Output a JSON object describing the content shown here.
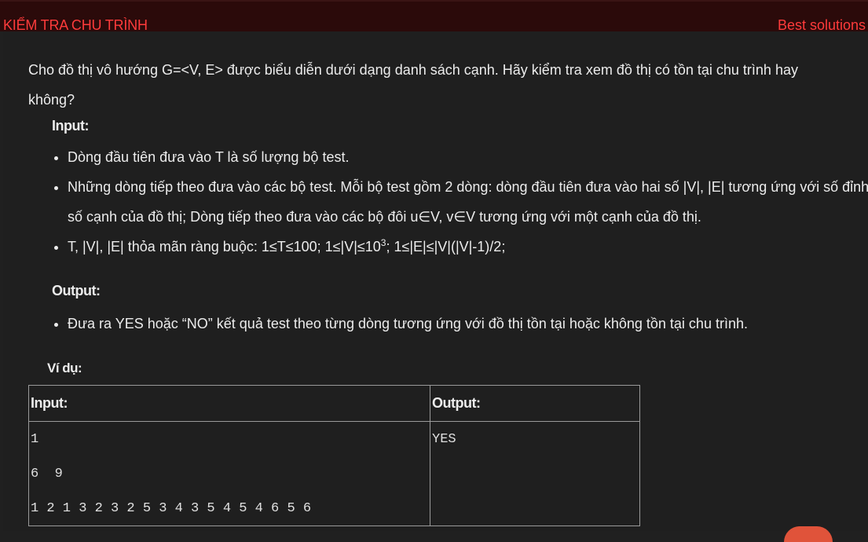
{
  "header": {
    "title": "KIỂM TRA CHU TRÌNH",
    "best_solutions": "Best solutions"
  },
  "problem": {
    "intro": "Cho đồ thị vô hướng G=<V, E> được biểu diễn dưới dạng danh sách cạnh. Hãy kiểm tra xem đồ thị có tồn tại chu trình hay không?",
    "input_heading": "Input:",
    "input_items": [
      "Dòng đầu tiên đưa vào T là số lượng bộ test.",
      "Những dòng tiếp theo đưa vào các bộ test. Mỗi bộ test gồm 2 dòng: dòng đầu tiên đưa vào hai số |V|, |E| tương ứng với số đỉnh,  số cạnh của đồ thị; Dòng tiếp theo đưa vào các bộ đôi u∈V, v∈V tương ứng với một cạnh của đồ thị."
    ],
    "constraint_before": "T, |V|, |E| thỏa mãn ràng buộc: 1≤T≤100; 1≤|V|≤10",
    "constraint_sup": "3",
    "constraint_after": "; 1≤|E|≤|V|(|V|-1)/2;",
    "output_heading": "Output:",
    "output_items": [
      "Đưa ra YES hoặc “NO” kết quả test theo từng dòng tương ứng với đồ thị tồn tại hoặc không tồn tại chu trình."
    ],
    "example_heading": "Ví dụ:"
  },
  "example": {
    "input_header": "Input:",
    "output_header": "Output:",
    "input_lines": [
      "1",
      "6  9",
      "1 2 1 3 2 3 2 5 3 4 3 5 4 5 4 6 5 6"
    ],
    "output_lines": [
      "YES"
    ]
  }
}
